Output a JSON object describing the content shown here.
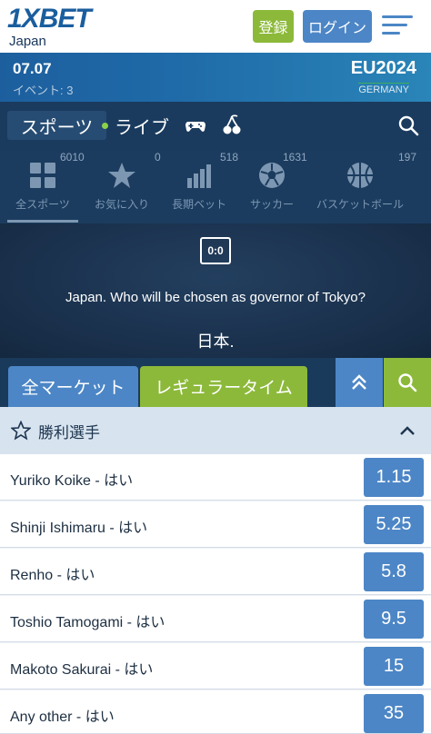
{
  "header": {
    "logo": "1XBET",
    "logo_sub": "Japan",
    "register_label": "登録",
    "login_label": "ログイン"
  },
  "promo": {
    "date": "07.07",
    "events": "イベント: 3",
    "title": "EU2024",
    "subtitle": "GERMANY"
  },
  "nav": {
    "sports": "スポーツ",
    "live": "ライブ"
  },
  "categories": [
    {
      "label": "全スポーツ",
      "count": "6010",
      "icon": "grid-icon"
    },
    {
      "label": "お気に入り",
      "count": "0",
      "icon": "star-icon"
    },
    {
      "label": "長期ベット",
      "count": "518",
      "icon": "bar-chart-icon"
    },
    {
      "label": "サッカー",
      "count": "1631",
      "icon": "soccer-ball-icon"
    },
    {
      "label": "バスケットボール",
      "count": "197",
      "icon": "basketball-icon"
    }
  ],
  "event": {
    "score": "0:0",
    "title": "Japan. Who will be chosen as governor of Tokyo?",
    "country": "日本."
  },
  "market_tabs": {
    "all": "全マーケット",
    "regular": "レギュラータイム"
  },
  "market": {
    "title": "勝利選手",
    "rows": [
      {
        "name": "Yuriko Koike - はい",
        "odds": "1.15"
      },
      {
        "name": "Shinji Ishimaru - はい",
        "odds": "5.25"
      },
      {
        "name": "Renho - はい",
        "odds": "5.8"
      },
      {
        "name": "Toshio Tamogami - はい",
        "odds": "9.5"
      },
      {
        "name": "Makoto Sakurai - はい",
        "odds": "15"
      },
      {
        "name": "Any other - はい",
        "odds": "35"
      }
    ]
  },
  "colors": {
    "brand_blue": "#4c86c6",
    "brand_green": "#8cb93a",
    "navy": "#1a3b5e"
  }
}
